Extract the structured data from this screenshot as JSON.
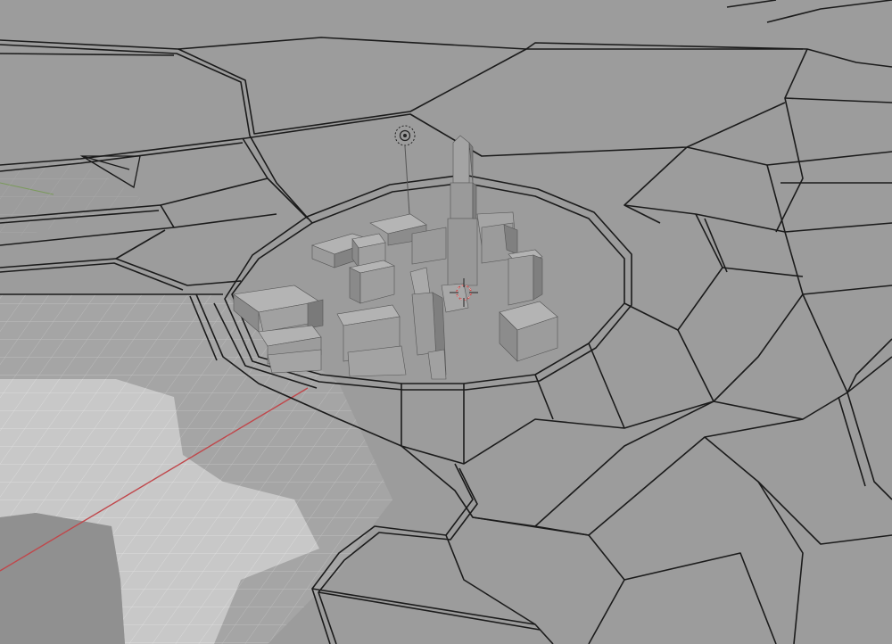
{
  "viewport": {
    "colors": {
      "background": "#8f8f8f",
      "mesh_face": "#9a9a9a",
      "grid_floor": "#a8a8a8",
      "highlight_face": "#c9c9c9",
      "wire": "#1a1a1a",
      "x_axis": "#c0474b",
      "y_axis": "#7a9a5a",
      "building_top": "#b0b0b0",
      "building_side": "#7c7c7c",
      "building_front": "#969696",
      "cursor": "#c83a3a"
    },
    "objects": [
      "camera-icon",
      "light-icon",
      "3d-cursor-icon",
      "city-buildings",
      "voronoi-road-mesh"
    ]
  }
}
